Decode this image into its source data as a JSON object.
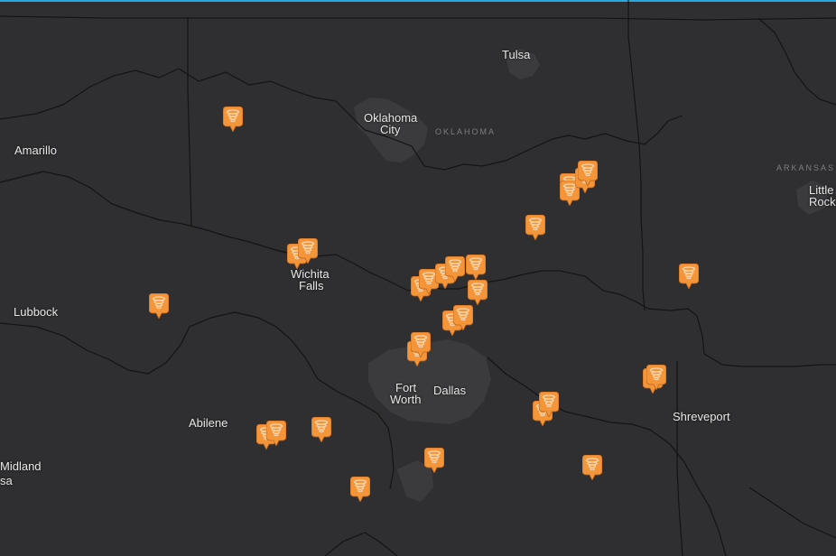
{
  "colors": {
    "background": "#2f2f31",
    "accent_bar": "#29a8e0",
    "boundary": "#141414",
    "urban": "#3b3b3d",
    "marker_fill": "#f5953a",
    "marker_inner": "#fbd8b0",
    "label": "#e6e6e6",
    "state_label": "#7d7d7d"
  },
  "marker_icon": "tornado-icon",
  "cities": {
    "tulsa": "Tulsa",
    "oklahoma_city_1": "Oklahoma",
    "oklahoma_city_2": "City",
    "amarillo": "Amarillo",
    "wichita_falls_1": "Wichita",
    "wichita_falls_2": "Falls",
    "lubbock": "Lubbock",
    "fort_worth_1": "Fort",
    "fort_worth_2": "Worth",
    "dallas": "Dallas",
    "abilene": "Abilene",
    "midland": "Midland",
    "odessa_partial": "sa",
    "shreveport": "Shreveport",
    "little_rock_1": "Little",
    "little_rock_2": "Rock"
  },
  "states": {
    "oklahoma": "OKLAHOMA",
    "arkansas": "ARKANSAS"
  }
}
